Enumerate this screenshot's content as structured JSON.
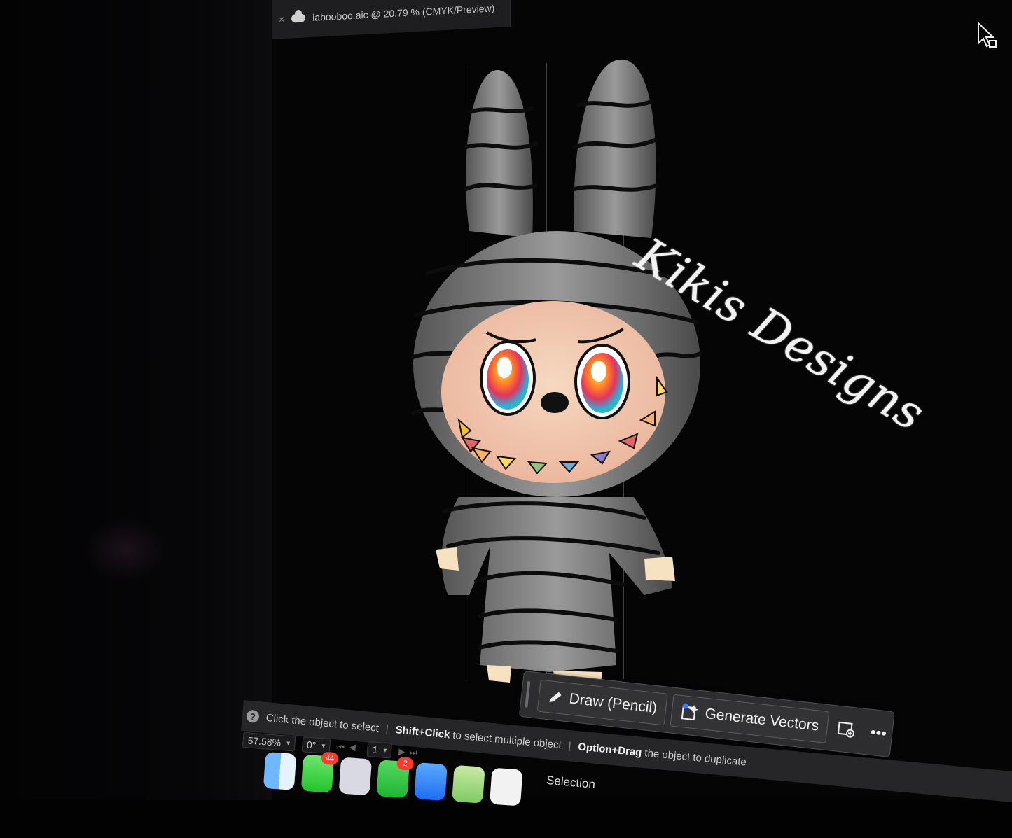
{
  "document": {
    "tab_title": "labooboo.aic @ 20.79 % (CMYK/Preview)",
    "close_glyph": "×"
  },
  "artwork": {
    "brand_text": "Kikis Designs"
  },
  "contextual_taskbar": {
    "draw_label": "Draw (Pencil)",
    "generate_label": "Generate Vectors",
    "more_glyph": "•••"
  },
  "status_bar": {
    "help_glyph": "?",
    "hint_1": "Click the object to select",
    "hint_2_key": "Shift+Click",
    "hint_2_text": " to select multiple object",
    "hint_3_key": "Option+Drag",
    "hint_3_text": " the object to duplicate",
    "separator": "|",
    "zoom": "57.58%",
    "rotation": "0°",
    "artboard": "1",
    "tool": "Selection"
  },
  "dock": {
    "messages_badge": "44",
    "facetime_badge": "2"
  },
  "colors": {
    "canvas": "#050506",
    "panel": "#2d2d30",
    "text": "#f1f1f1"
  }
}
